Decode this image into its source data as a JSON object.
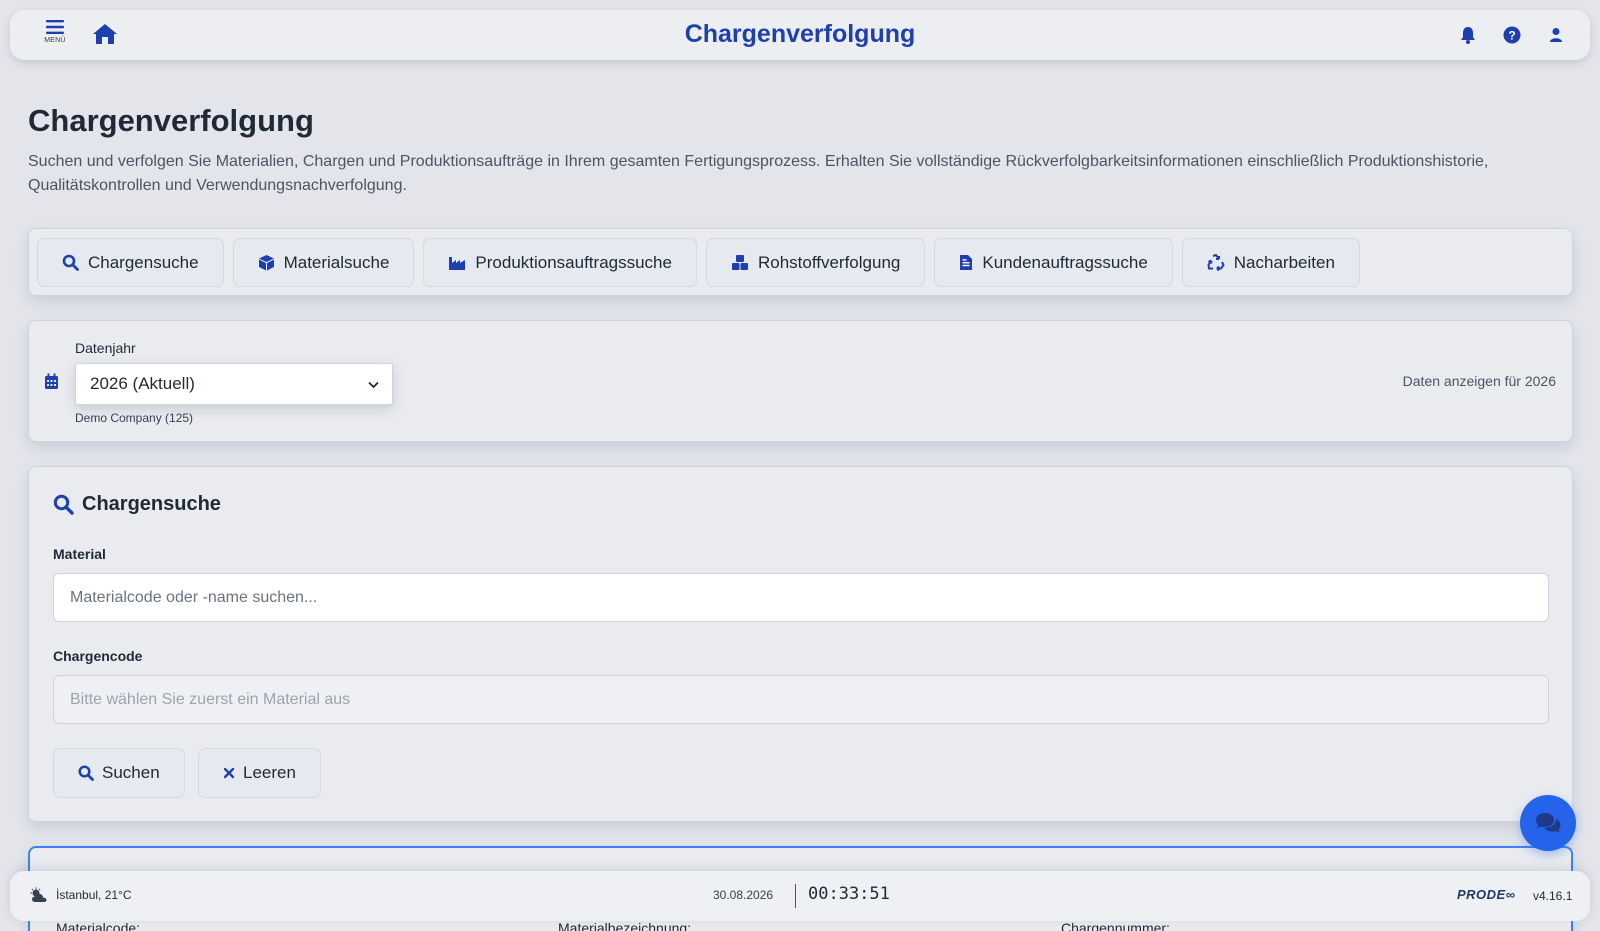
{
  "header": {
    "menu_label": "MENÜ",
    "title": "Chargenverfolgung",
    "icons": [
      "bell-icon",
      "help-icon",
      "user-icon"
    ]
  },
  "page": {
    "title": "Chargenverfolgung",
    "description": "Suchen und verfolgen Sie Materialien, Chargen und Produktionsaufträge in Ihrem gesamten Fertigungsprozess. Erhalten Sie vollständige Rückverfolgbarkeitsinformationen einschließlich Produktionshistorie, Qualitätskontrollen und Verwendungsnachverfolgung."
  },
  "tabs": [
    {
      "label": "Chargensuche",
      "icon": "search-icon"
    },
    {
      "label": "Materialsuche",
      "icon": "box-icon"
    },
    {
      "label": "Produktionsauftragssuche",
      "icon": "factory-icon"
    },
    {
      "label": "Rohstoffverfolgung",
      "icon": "boxes-icon"
    },
    {
      "label": "Kundenauftragssuche",
      "icon": "document-icon"
    },
    {
      "label": "Nacharbeiten",
      "icon": "recycle-icon"
    }
  ],
  "year_filter": {
    "label": "Datenjahr",
    "selected": "2026 (Aktuell)",
    "company": "Demo Company (125)",
    "note": "Daten anzeigen für 2026"
  },
  "search": {
    "title": "Chargensuche",
    "material_label": "Material",
    "material_placeholder": "Materialcode oder -name suchen...",
    "batch_label": "Chargencode",
    "batch_placeholder": "Bitte wählen Sie zuerst ein Material aus",
    "search_button": "Suchen",
    "clear_button": "Leeren"
  },
  "results": {
    "material_code_label": "Materialcode:",
    "material_name_label": "Materialbezeichnung:",
    "batch_number_label": "Chargennummer:"
  },
  "footer": {
    "weather": "İstanbul, 21°C",
    "date": "30.08.2026",
    "time": "00:33:51",
    "brand": "PRODE∞",
    "version": "v4.16.1"
  },
  "colors": {
    "accent": "#1e40af",
    "chat_button": "#2563eb",
    "background": "#e3e5ea"
  }
}
